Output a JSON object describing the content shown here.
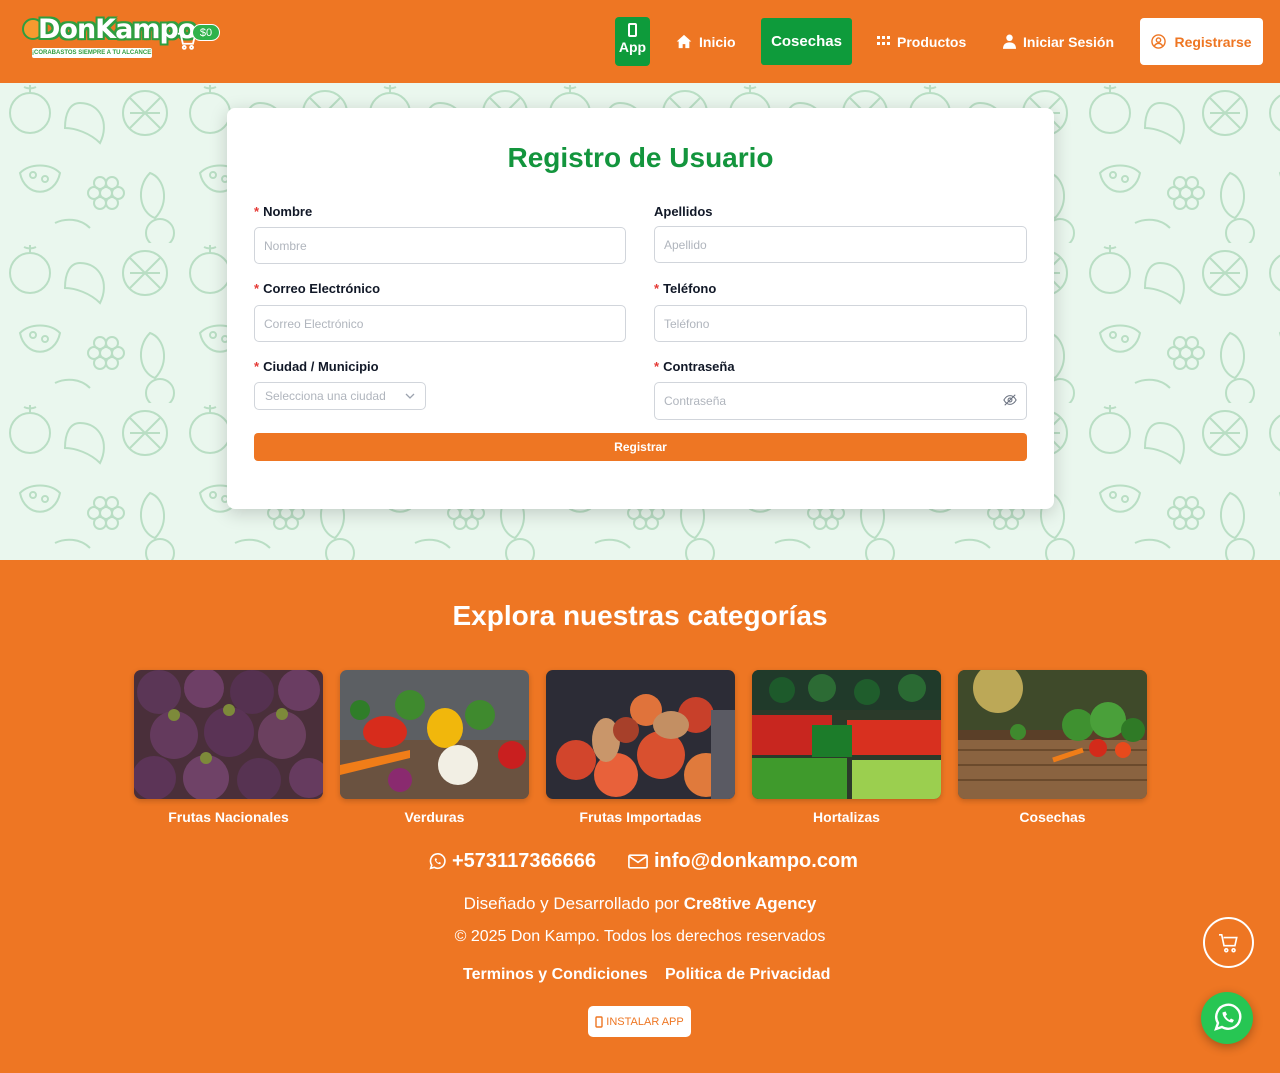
{
  "header": {
    "logo_text": "DonKampo",
    "logo_tagline": "¡CORABASTOS SIEMPRE A TU ALCANCE!",
    "cart_total": "$0",
    "nav": {
      "app": "App",
      "inicio": "Inicio",
      "cosechas": "Cosechas",
      "productos": "Productos",
      "login": "Iniciar Sesión",
      "register": "Registrarse"
    }
  },
  "form": {
    "title": "Registro de Usuario",
    "nombre": {
      "label": "Nombre",
      "placeholder": "Nombre",
      "required": true
    },
    "apellidos": {
      "label": "Apellidos",
      "placeholder": "Apellido",
      "required": false
    },
    "correo": {
      "label": "Correo Electrónico",
      "placeholder": "Correo Electrónico",
      "required": true
    },
    "telefono": {
      "label": "Teléfono",
      "placeholder": "Teléfono",
      "required": true
    },
    "ciudad": {
      "label": "Ciudad / Municipio",
      "placeholder": "Selecciona una ciudad",
      "required": true
    },
    "contrasena": {
      "label": "Contraseña",
      "placeholder": "Contraseña",
      "required": true
    },
    "required_mark": "*",
    "submit": "Registrar"
  },
  "footer": {
    "title": "Explora nuestras categorías",
    "categories": [
      {
        "label": "Frutas Nacionales"
      },
      {
        "label": "Verduras"
      },
      {
        "label": "Frutas Importadas"
      },
      {
        "label": "Hortalizas"
      },
      {
        "label": "Cosechas"
      }
    ],
    "phone": "+573117366666",
    "email": "info@donkampo.com",
    "credit_prefix": "Diseñado y Desarrollado por",
    "credit_agency": "Cre8tive Agency",
    "copyright": "© 2025 Don Kampo. Todos los derechos reservados",
    "terms": "Terminos y Condiciones",
    "privacy": "Politica de Privacidad",
    "install": "INSTALAR APP"
  },
  "colors": {
    "brand_orange": "#ee7623",
    "brand_green": "#0e9b3b",
    "title_green": "#13953d",
    "pattern_bg": "#eaf7ee",
    "whatsapp": "#27c653"
  },
  "icons": [
    "cart-icon",
    "phone-icon",
    "home-icon",
    "grid-icon",
    "user-icon",
    "user-circle-icon",
    "chevron-down-icon",
    "eye-slash-icon",
    "whatsapp-icon",
    "mail-icon"
  ]
}
